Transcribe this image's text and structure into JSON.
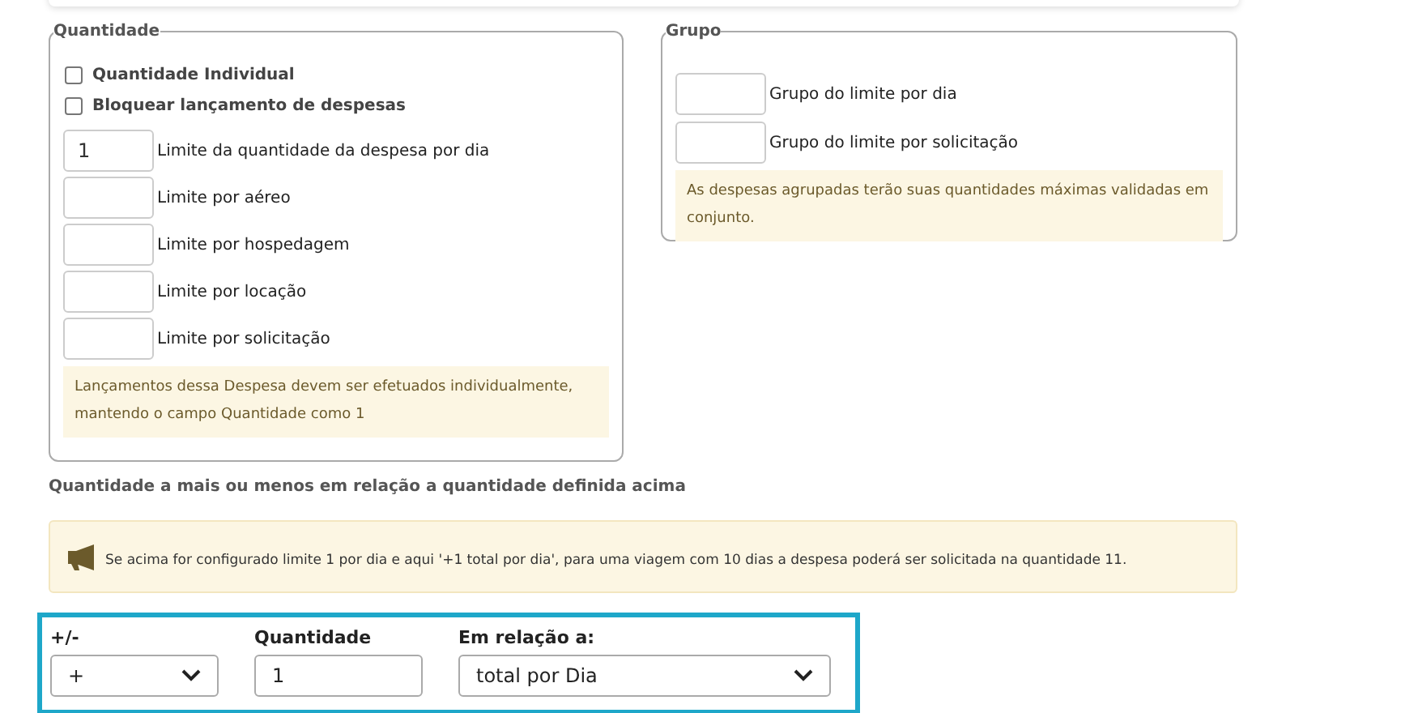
{
  "quantidade": {
    "legend": "Quantidade",
    "checkboxes": [
      {
        "label": "Quantidade Individual",
        "checked": false
      },
      {
        "label": "Bloquear lançamento de despesas",
        "checked": false
      }
    ],
    "limits": [
      {
        "value": "1",
        "label": "Limite da quantidade da despesa por dia"
      },
      {
        "label": "Limite por aéreo"
      },
      {
        "label": "Limite por hospedagem"
      },
      {
        "label": "Limite por locação"
      },
      {
        "label": "Limite por solicitação"
      }
    ],
    "note": "Lançamentos dessa Despesa devem ser efetuados individualmente, mantendo o campo Quantidade como 1"
  },
  "grupo": {
    "legend": "Grupo",
    "limits": [
      {
        "label": "Grupo do limite por dia"
      },
      {
        "label": "Grupo do limite por solicitação"
      }
    ],
    "note": "As despesas agrupadas terão suas quantidades máximas validadas em conjunto."
  },
  "extra": {
    "heading": "Quantidade a mais ou menos em relação a quantidade definida acima",
    "tip": "Se acima for configurado limite 1 por dia e aqui '+1 total por dia', para uma viagem com 10 dias a despesa poderá ser solicitada na quantidade 11.",
    "fields": [
      {
        "kind": "select",
        "label": "+/-",
        "value": "+"
      },
      {
        "kind": "input",
        "label": "Quantidade",
        "value": "1"
      },
      {
        "kind": "select",
        "label": "Em relação a:",
        "value": "total por Dia"
      }
    ]
  }
}
